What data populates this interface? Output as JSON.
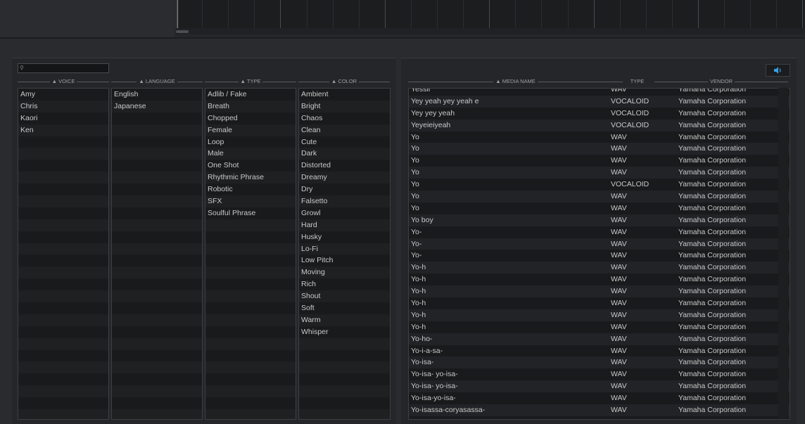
{
  "search": {
    "placeholder": ""
  },
  "voice_header": "▲ VOICE",
  "language_header": "▲ LANGUAGE",
  "type_header": "▲ TYPE",
  "color_header": "▲ COLOR",
  "media_header": "▲ MEDIA NAME",
  "media_type_header": "TYPE",
  "vendor_header": "VENDOR",
  "voices": [
    "Amy",
    "Chris",
    "Kaori",
    "Ken"
  ],
  "languages": [
    "English",
    "Japanese"
  ],
  "types": [
    "Adlib / Fake",
    "Breath",
    "Chopped",
    "Female",
    "Loop",
    "Male",
    "One Shot",
    "Rhythmic Phrase",
    "Robotic",
    "SFX",
    "Soulful Phrase"
  ],
  "colors": [
    "Ambient",
    "Bright",
    "Chaos",
    "Clean",
    "Cute",
    "Dark",
    "Distorted",
    "Dreamy",
    "Dry",
    "Falsetto",
    "Growl",
    "Hard",
    "Husky",
    "Lo-Fi",
    "Low Pitch",
    "Moving",
    "Rich",
    "Shout",
    "Soft",
    "Warm",
    "Whisper"
  ],
  "media_rows": [
    [
      "Yessir",
      "WAV",
      "Yamaha Corporation"
    ],
    [
      "Yey yeah yey yeah e",
      "VOCALOID",
      "Yamaha Corporation"
    ],
    [
      "Yey yey yeah",
      "VOCALOID",
      "Yamaha Corporation"
    ],
    [
      "Yeyeieiyeah",
      "VOCALOID",
      "Yamaha Corporation"
    ],
    [
      "Yo",
      "WAV",
      "Yamaha Corporation"
    ],
    [
      "Yo",
      "WAV",
      "Yamaha Corporation"
    ],
    [
      "Yo",
      "WAV",
      "Yamaha Corporation"
    ],
    [
      "Yo",
      "WAV",
      "Yamaha Corporation"
    ],
    [
      "Yo",
      "VOCALOID",
      "Yamaha Corporation"
    ],
    [
      "Yo",
      "WAV",
      "Yamaha Corporation"
    ],
    [
      "Yo",
      "WAV",
      "Yamaha Corporation"
    ],
    [
      "Yo boy",
      "WAV",
      "Yamaha Corporation"
    ],
    [
      "Yo-",
      "WAV",
      "Yamaha Corporation"
    ],
    [
      "Yo-",
      "WAV",
      "Yamaha Corporation"
    ],
    [
      "Yo-",
      "WAV",
      "Yamaha Corporation"
    ],
    [
      "Yo-h",
      "WAV",
      "Yamaha Corporation"
    ],
    [
      "Yo-h",
      "WAV",
      "Yamaha Corporation"
    ],
    [
      "Yo-h",
      "WAV",
      "Yamaha Corporation"
    ],
    [
      "Yo-h",
      "WAV",
      "Yamaha Corporation"
    ],
    [
      "Yo-h",
      "WAV",
      "Yamaha Corporation"
    ],
    [
      "Yo-h",
      "WAV",
      "Yamaha Corporation"
    ],
    [
      "Yo-ho-",
      "WAV",
      "Yamaha Corporation"
    ],
    [
      "Yo-i-a-sa-",
      "WAV",
      "Yamaha Corporation"
    ],
    [
      "Yo-isa-",
      "WAV",
      "Yamaha Corporation"
    ],
    [
      "Yo-isa- yo-isa-",
      "WAV",
      "Yamaha Corporation"
    ],
    [
      "Yo-isa- yo-isa-",
      "WAV",
      "Yamaha Corporation"
    ],
    [
      "Yo-isa-yo-isa-",
      "WAV",
      "Yamaha Corporation"
    ],
    [
      "Yo-isassa-coryasassa-",
      "WAV",
      "Yamaha Corporation"
    ]
  ],
  "icons": {
    "search": "search-icon",
    "speaker": "speaker-icon"
  },
  "colors_theme": {
    "accent": "#3aa0e8",
    "bg": "#2a2b2e"
  }
}
